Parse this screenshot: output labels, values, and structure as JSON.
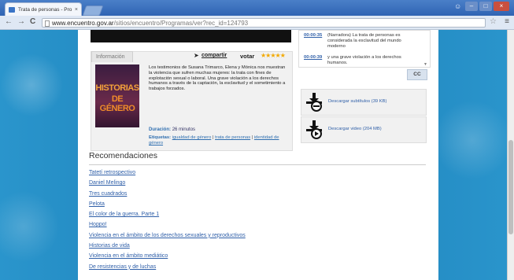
{
  "browser": {
    "tab_title": "Trata de personas - Pro",
    "tab_close": "×",
    "url_host": "www.encuentro.gov.ar",
    "url_path": "/sitios/encuentro/Programas/ver?rec_id=124793",
    "back": "←",
    "forward": "→",
    "reload": "C",
    "star": "☆",
    "menu": "≡",
    "win_min": "–",
    "win_max": "□",
    "win_close": "×"
  },
  "info": {
    "tab_label": "Información",
    "share_label": "compartir",
    "vote_label": "votar",
    "stars": "★★★★★",
    "poster_line1": "HISTORIAS",
    "poster_line2": "DE GÉNERO",
    "description": "Los testimonios de Susana Trimarco, Elena y Mónica nos muestran la violencia que sufren muchas mujeres: la trata con fines de explotación sexual o laboral. Una grave violación a los derechos humanos a través de la captación, la esclavitud y el sometimiento a trabajos forzados.",
    "duration_label": "Duración:",
    "duration_value": "26 minutos",
    "tags_label": "Etiquetas:",
    "tags": [
      "igualdad de género",
      "trata de personas",
      "identidad de género"
    ]
  },
  "transcript": [
    {
      "time": "00:00:35",
      "text": "(Narradora) La trata de personas es considerada la esclavitud del mundo moderno"
    },
    {
      "time": "00:00:39",
      "text": "y una grave violación a los derechos humanos."
    }
  ],
  "cc_label": "CC",
  "downloads": [
    {
      "label": "Descargar subtítulos (39 KB)",
      "icon": "download-subtitles-icon"
    },
    {
      "label": "Descargar video (204 MB)",
      "icon": "download-video-icon"
    }
  ],
  "recommendations": {
    "title": "Recomendaciones",
    "items": [
      "Tatetí retrospectivo",
      "Daniel Melingo",
      "Tres cuadrados",
      "Pelota",
      "El color de la guerra. Parte 1",
      "Hoppo!",
      "Violencia en el ámbito de los derechos sexuales y reproductivos",
      "Historias de vida",
      "Violencia en el ámbito mediático",
      "De resistencias y de luchas"
    ]
  }
}
